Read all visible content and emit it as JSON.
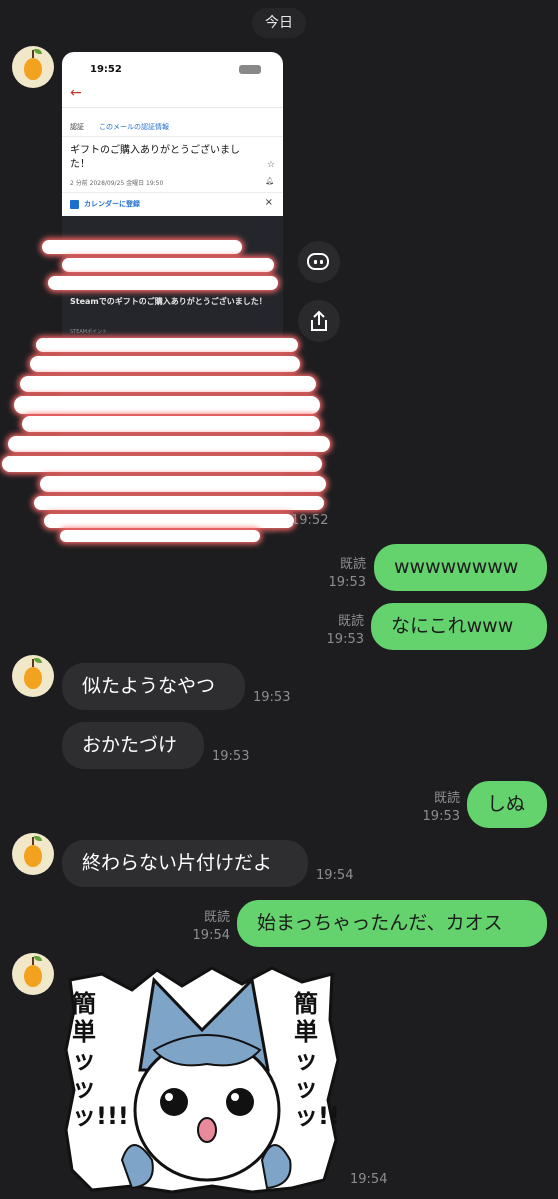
{
  "date_label": "今日",
  "shared_image": {
    "status_time": "19:52",
    "auth_label": "認証",
    "auth_link": "このメールの認証情報",
    "subject": "ギフトのご購入ありがとうございました！",
    "meta": "2 分前 2028/09/25 金曜日 19:50",
    "calendar_label": "カレンダーに登録",
    "body_title": "Steamでのギフトのご購入ありがとうございました！",
    "body_sub": "STEAMポイント",
    "time": "19:52"
  },
  "messages": [
    {
      "side": "out",
      "read": "既読",
      "time": "19:53",
      "text": "wwwwwwww"
    },
    {
      "side": "out",
      "read": "既読",
      "time": "19:53",
      "text": "なにこれwww"
    },
    {
      "side": "in",
      "time": "19:53",
      "text": "似たようなやつ"
    },
    {
      "side": "in",
      "time": "19:53",
      "text": "おかたづけ"
    },
    {
      "side": "out",
      "read": "既読",
      "time": "19:53",
      "text": "しぬ"
    },
    {
      "side": "in",
      "time": "19:54",
      "text": "終わらない片付けだよ"
    },
    {
      "side": "out",
      "read": "既読",
      "time": "19:54",
      "text": "始まっちゃったんだ、カオス"
    }
  ],
  "sticker": {
    "left_text": "簡単ッッッ!!!",
    "right_text": "簡単ッッッ!!",
    "time": "19:54"
  },
  "colors": {
    "background": "#1d1d1f",
    "incoming_bubble": "#2e2e31",
    "outgoing_bubble": "#64d36e",
    "avatar_fruit": "#f2a21f"
  },
  "icons": [
    "pear-avatar-icon",
    "bot-icon",
    "share-icon",
    "back-arrow-icon",
    "calendar-icon",
    "star-icon",
    "bell-icon",
    "close-icon"
  ]
}
